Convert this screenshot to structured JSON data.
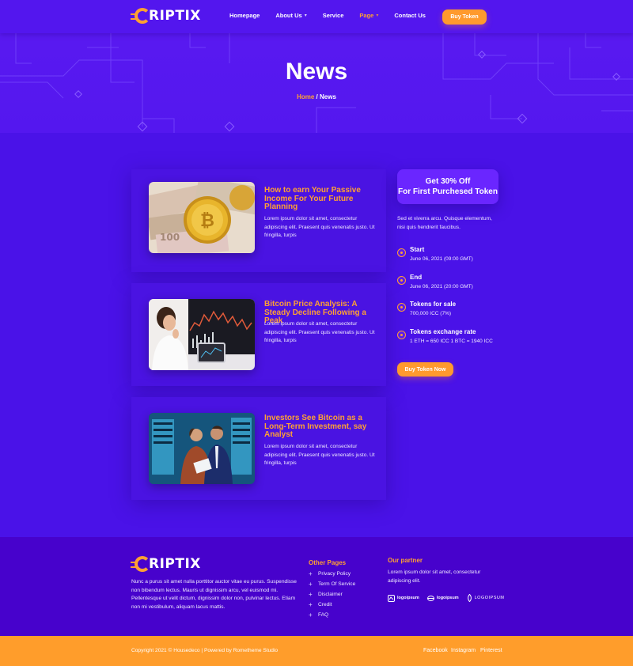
{
  "brand": {
    "name": "RIPTIX",
    "accent": "#ffa033",
    "background": "#4a12e8"
  },
  "nav": {
    "items": [
      {
        "label": "Homepage",
        "dropdown": false,
        "active": false
      },
      {
        "label": "About Us",
        "dropdown": true,
        "active": false
      },
      {
        "label": "Service",
        "dropdown": false,
        "active": false
      },
      {
        "label": "Page",
        "dropdown": true,
        "active": true
      },
      {
        "label": "Contact Us",
        "dropdown": false,
        "active": false
      }
    ],
    "cta": "Buy Token"
  },
  "hero": {
    "title": "News",
    "breadcrumb": {
      "home": "Home",
      "separator": " / ",
      "current": "News"
    }
  },
  "posts": [
    {
      "title": "How to earn Your Passive Income For Your Future Planning",
      "excerpt": "Lorem ipsum dolor sit amet, consectetur adipiscing elit. Praesent quis venenatis justo. Ut fringilla, turpis",
      "image": "bitcoin-coins-on-banknotes"
    },
    {
      "title": "Bitcoin Price Analysis: A Steady Decline Following a Peak",
      "excerpt": "Lorem ipsum dolor sit amet, consectetur adipiscing elit. Praesent quis venenatis justo. Ut fringilla, turpis",
      "image": "woman-watching-trading-charts"
    },
    {
      "title": "Investors See Bitcoin as a Long-Term Investment, say Analyst",
      "excerpt": "Lorem ipsum dolor sit amet, consectetur adipiscing elit. Praesent quis venenatis justo. Ut fringilla, turpis",
      "image": "two-men-in-server-room"
    }
  ],
  "sidebar": {
    "promo": {
      "line1": "Get 30% Off",
      "line2": "For First Purchesed Token"
    },
    "text": "Sed et viverra arcu. Quisque elementum, nisi quis hendrerit faucibus.",
    "info": [
      {
        "label": "Start",
        "value": "June 06, 2021 (09:00 GMT)"
      },
      {
        "label": "End",
        "value": "June 06, 2021 (20:00 GMT)"
      },
      {
        "label": "Tokens for sale",
        "value": "700,000 ICC (7%)"
      },
      {
        "label": "Tokens exchange rate",
        "value": "1 ETH = 650 ICC 1 BTC = 1940 ICC"
      }
    ],
    "button": "Buy Token Now"
  },
  "footer": {
    "description": "Nunc a purus sit amet nulla porttitor auctor vitae eu purus. Suspendisse non bibendum lectus. Mauris ut dignissim arcu, vel euismod mi. Pellentesque ut velit dictum, dignissim dolor non, pulvinar lectus. Etiam non mi vestibulum, aliquam lacus mattis.",
    "other_pages": {
      "heading": "Other Pages",
      "links": [
        "Privacy Policy",
        "Term Of Service",
        "Disclaimer",
        "Credit",
        "FAQ"
      ]
    },
    "partner": {
      "heading": "Our partner",
      "text": "Lorem ipsum dolor sit amet, consectetur adipiscing elit.",
      "logos": [
        "logoipsum",
        "logoipsum",
        "LOGOIPSUM"
      ]
    },
    "copyright": "Copyright 2021 © Housedeco | Powered by Rometheme Studio",
    "social": [
      "Facebook",
      "Instagram",
      "Pinterest"
    ],
    "bar_color": "#ff9d2b"
  }
}
